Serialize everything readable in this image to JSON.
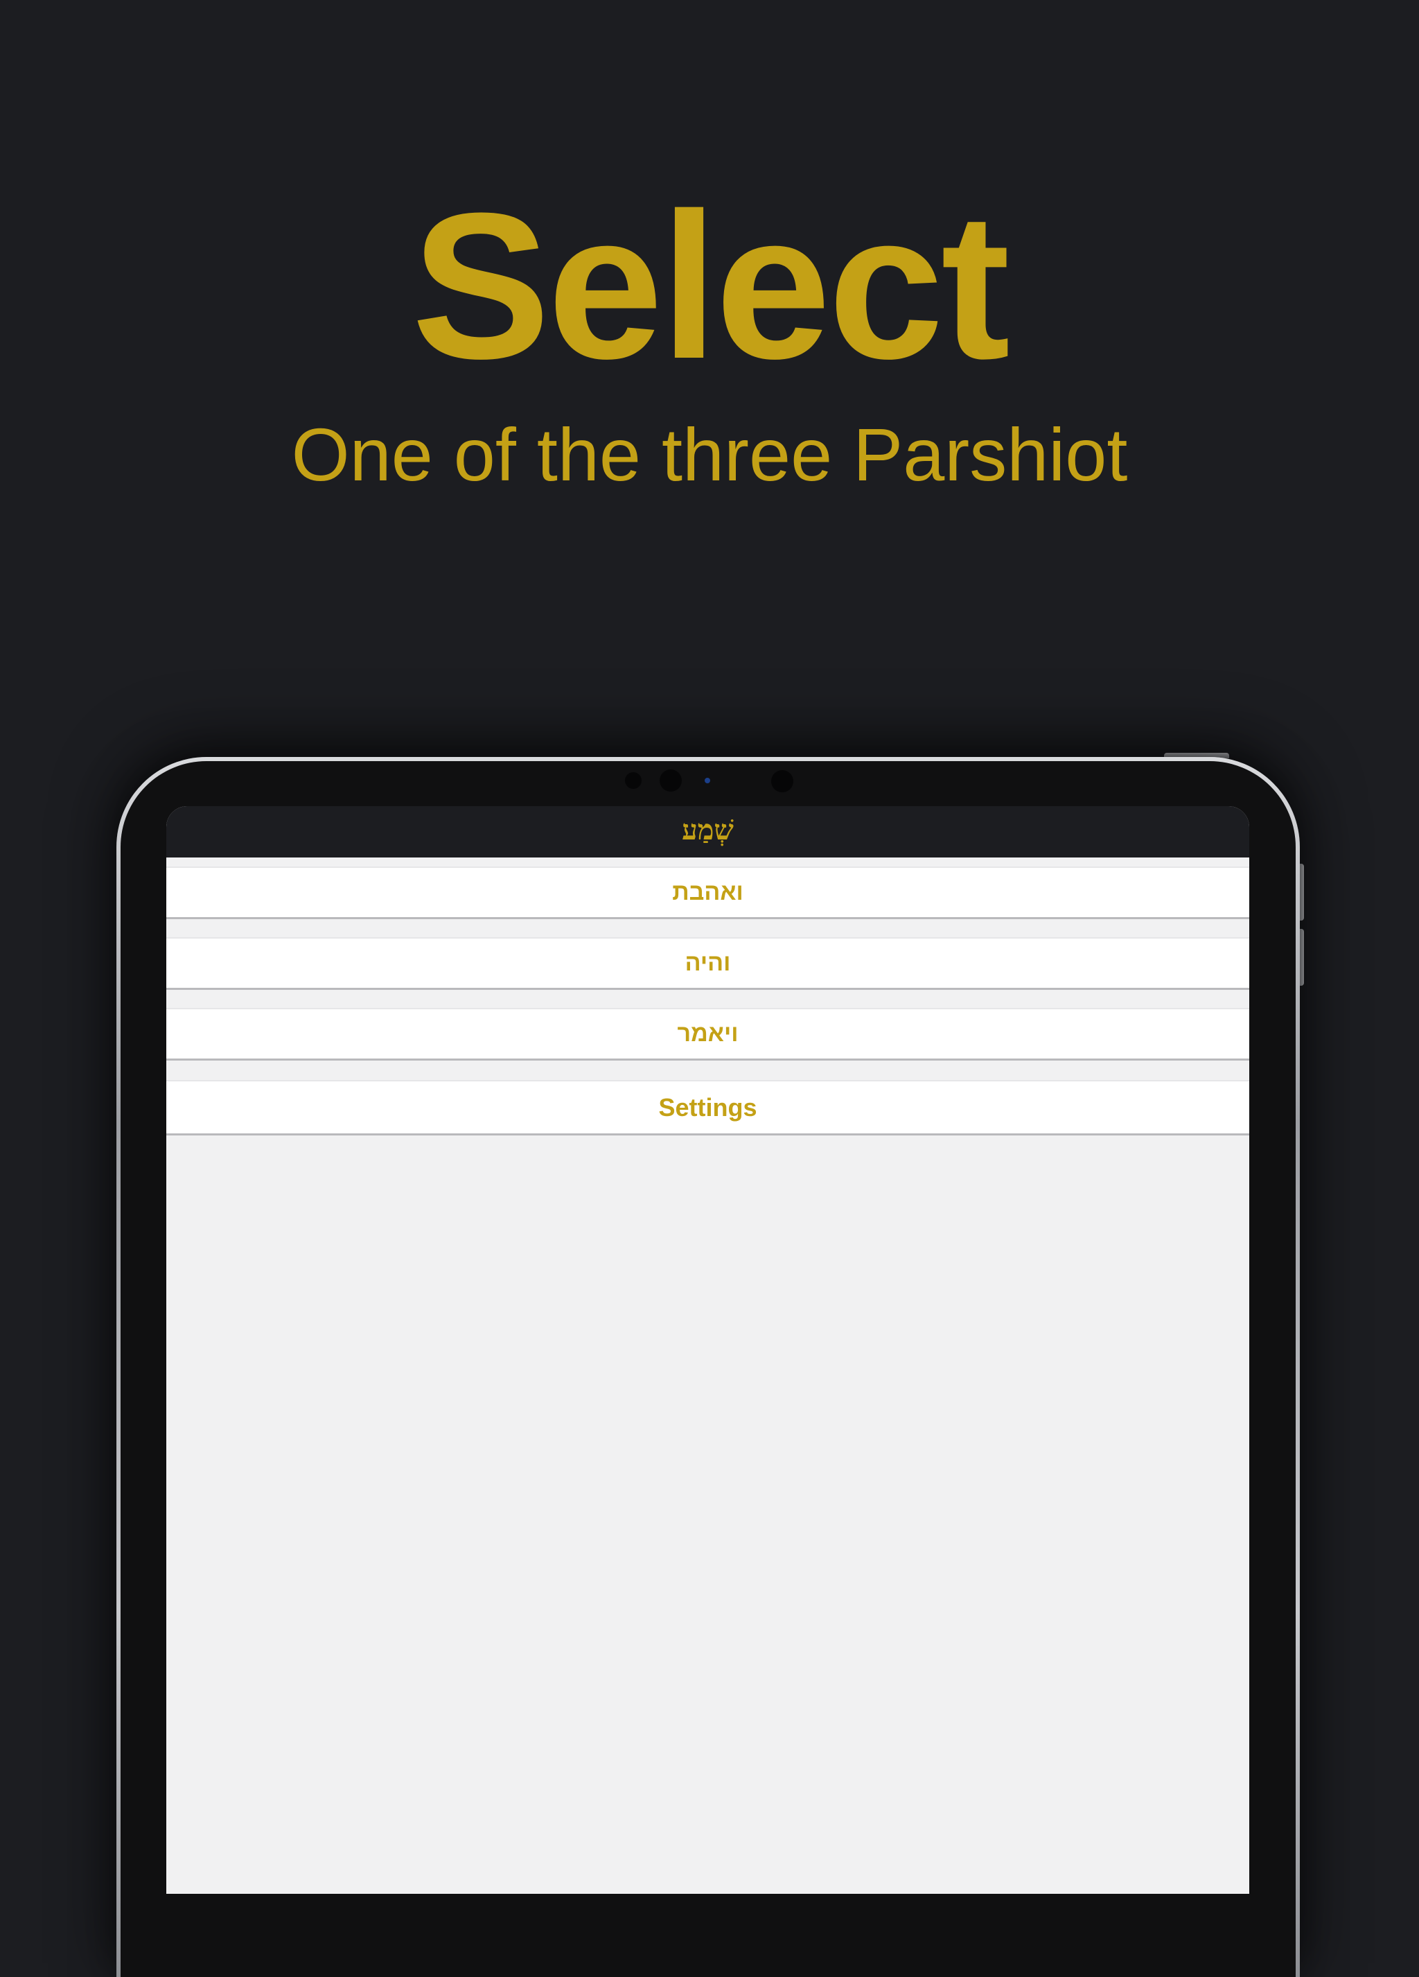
{
  "promo": {
    "headline": "Select",
    "subheadline": "One of the three Parshiot"
  },
  "app": {
    "nav_title": "שְׁמַע",
    "menu_items": [
      {
        "label": "ואהבת"
      },
      {
        "label": "והיה"
      },
      {
        "label": "ויאמר"
      },
      {
        "label": "Settings"
      }
    ]
  },
  "colors": {
    "background": "#1c1d21",
    "accent_gold": "#c4a116",
    "screen_background": "#f1f1f2",
    "row_background": "#ffffff"
  }
}
